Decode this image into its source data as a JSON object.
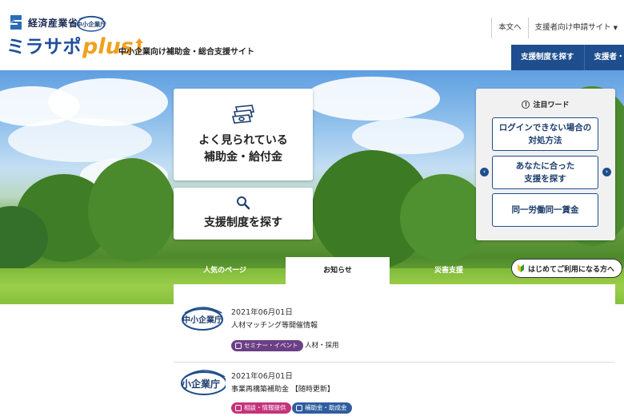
{
  "header": {
    "ministry": "経済産業省",
    "sme_logo_text": "中小企業庁",
    "brand_mira": "ミラサポ",
    "brand_plus": "plus",
    "site_subtitle": "中小企業向け補助金・総合支援サイト",
    "util_nav": [
      "本文へ",
      "支援者向け申請サイト"
    ],
    "main_nav": [
      "支援制度を探す",
      "支援者・支"
    ]
  },
  "hero": {
    "popular_card": {
      "title_line1": "よく見られている",
      "title_line2": "補助金・給付金"
    },
    "search_card": {
      "title": "支援制度を探す"
    },
    "panel": {
      "heading": "注目ワード",
      "keywords": [
        {
          "line1": "ログインできない場合の",
          "line2": "対処方法"
        },
        {
          "line1": "あなたに合った",
          "line2": "支援を探す"
        },
        {
          "line1": "同一労働同一賃金",
          "line2": ""
        }
      ]
    },
    "tabs": [
      "人気のページ",
      "お知らせ",
      "災害支援"
    ],
    "first_time_button": "はじめてご利用になる方へ"
  },
  "news": [
    {
      "logo": "中小企業庁",
      "date": "2021年06月01日",
      "title": "人材マッチング等開催情報",
      "tags": [
        {
          "label": "セミナー・イベント",
          "color": "#6b3f86"
        }
      ],
      "category": "人材・採用"
    },
    {
      "logo": "小企業庁",
      "date": "2021年06月01日",
      "title": "事業再構築補助金 【随時更新】",
      "tags": [
        {
          "label": "相談・情報提供",
          "color": "#c4337a"
        },
        {
          "label": "補助金・助成金",
          "color": "#2e5d9f"
        }
      ]
    }
  ],
  "colors": {
    "brand_blue": "#1e4e8e",
    "brand_orange": "#f0a020",
    "nav_bg": "#1e4e8e"
  }
}
